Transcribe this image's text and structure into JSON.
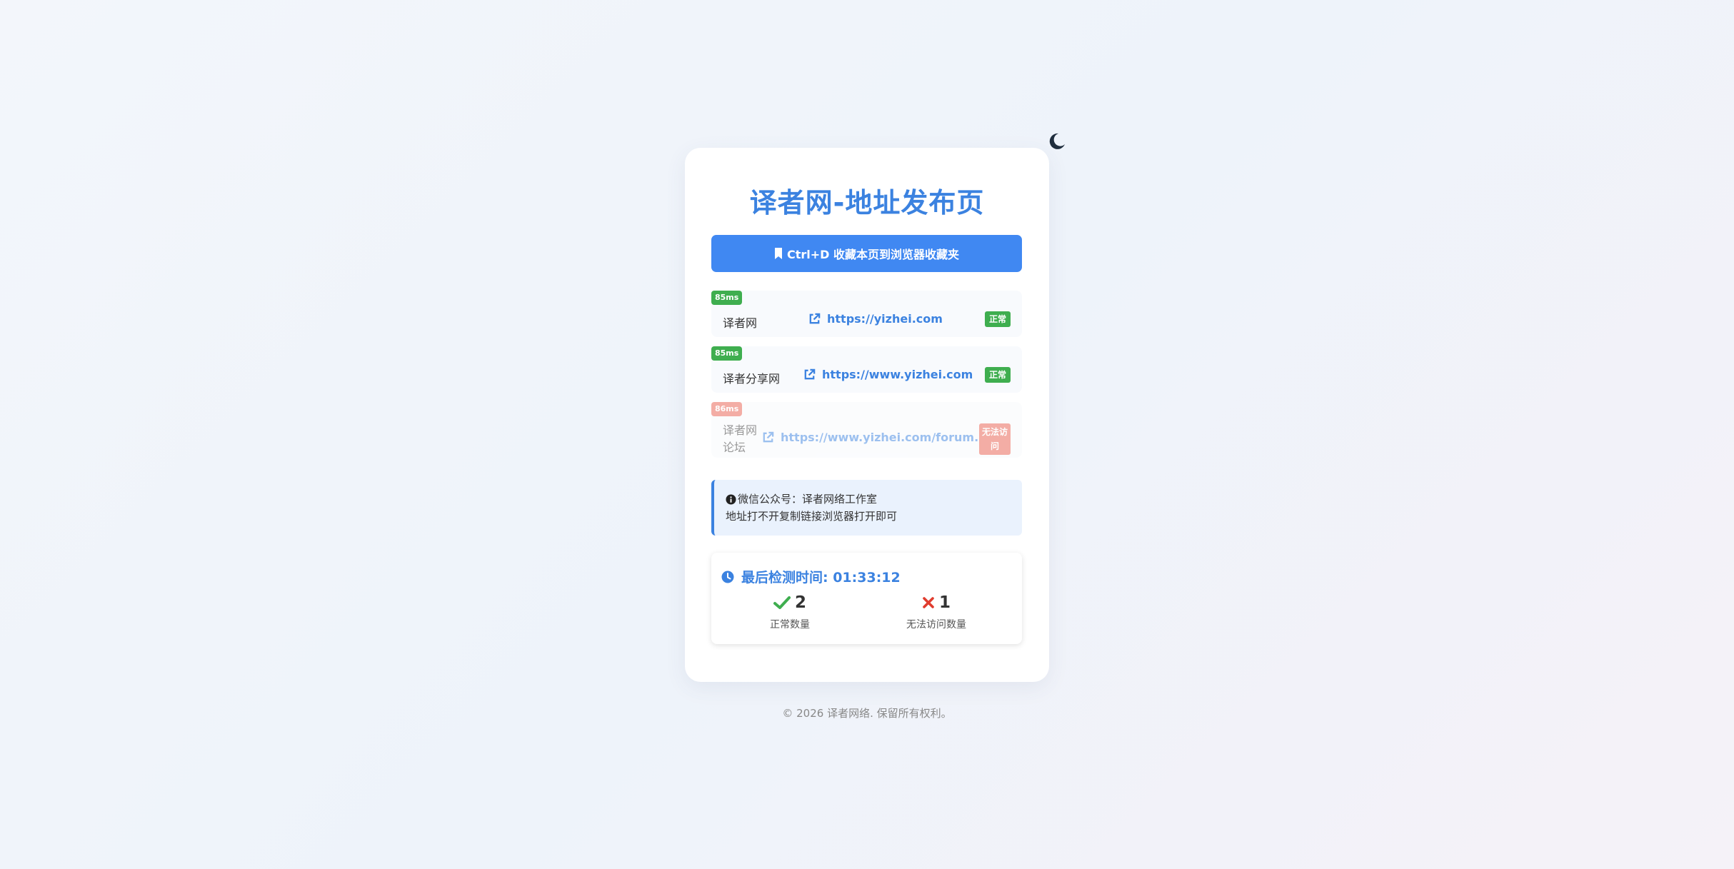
{
  "title": "译者网-地址发布页",
  "bookmark_button": "Ctrl+D 收藏本页到浏览器收藏夹",
  "links": [
    {
      "latency": "85ms",
      "name": "译者网",
      "url": "https://yizhei.com",
      "status": "正常"
    },
    {
      "latency": "85ms",
      "name": "译者分享网",
      "url": "https://www.yizhei.com",
      "status": "正常"
    },
    {
      "latency": "86ms",
      "name": "译者网论坛",
      "url": "https://www.yizhei.com/forum.php",
      "status": "无法访问"
    }
  ],
  "notice": {
    "line1": "微信公众号：译者网络工作室",
    "line2": "地址打不开复制链接浏览器打开即可"
  },
  "check": {
    "title": "最后检测时间: 01:33:12",
    "ok_count": "2",
    "ok_label": "正常数量",
    "bad_count": "1",
    "bad_label": "无法访问数量"
  },
  "footer": "© 2026 译者网络. 保留所有权利。",
  "colors": {
    "accent": "#3b82e0",
    "button": "#4088f2",
    "ok": "#3fae4f",
    "bad": "#e85d4d"
  },
  "icons": {
    "theme_toggle": "moon-icon",
    "bookmark": "bookmark-icon",
    "link": "external-link-icon",
    "info": "info-circle-icon",
    "clock": "clock-icon",
    "ok": "check-icon",
    "bad": "x-icon"
  }
}
